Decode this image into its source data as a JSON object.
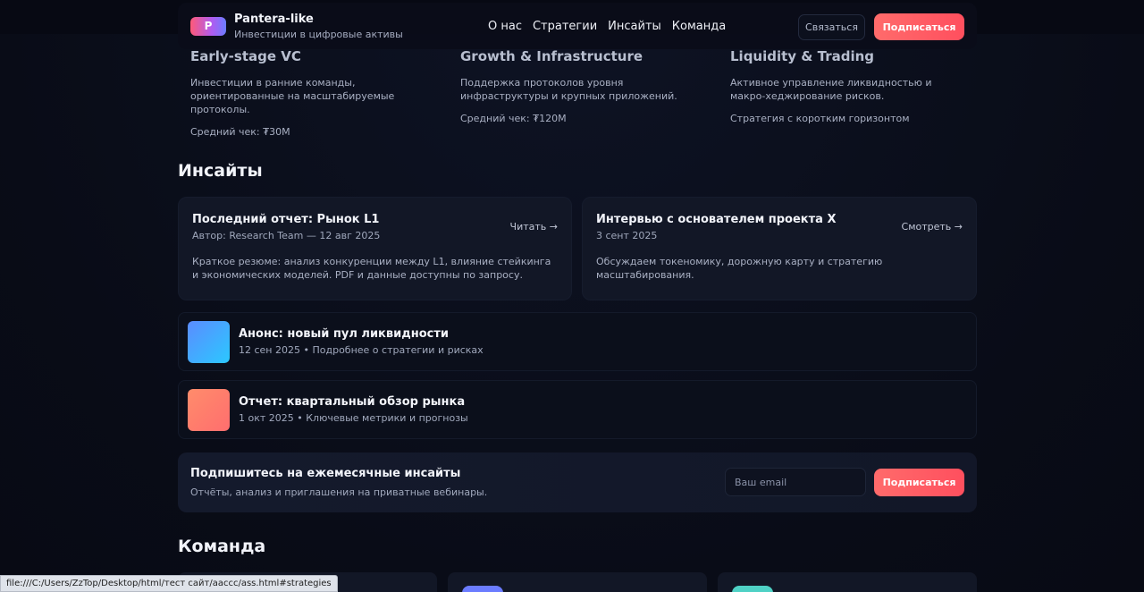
{
  "header": {
    "logo_letter": "P",
    "brand_name": "Pantera-like",
    "brand_tagline": "Инвестиции в цифровые активы",
    "nav": [
      "О нас",
      "Стратегии",
      "Инсайты",
      "Команда"
    ],
    "contact_label": "Связаться",
    "subscribe_label": "Подписаться"
  },
  "strategies": [
    {
      "title": "Early-stage VC",
      "desc": "Инвестиции в ранние команды, ориентированные на масштабируемые протоколы.",
      "meta": "Средний чек: ₮30M"
    },
    {
      "title": "Growth & Infrastructure",
      "desc": "Поддержка протоколов уровня инфраструктуры и крупных приложений.",
      "meta": "Средний чек: ₮120M"
    },
    {
      "title": "Liquidity & Trading",
      "desc": "Активное управление ликвидностью и макро-хеджирование рисков.",
      "meta": "Стратегия с коротким горизонтом"
    }
  ],
  "insights": {
    "title": "Инсайты",
    "cards": [
      {
        "title": "Последний отчет: Рынок L1",
        "sub": "Автор: Research Team — 12 авг 2025",
        "desc": "Краткое резюме: анализ конкуренции между L1, влияние стейкинга и экономических моделей. PDF и данные доступны по запросу.",
        "action": "Читать →"
      },
      {
        "title": "Интервью с основателем проекта X",
        "sub": "3 сент 2025",
        "desc": "Обсуждаем токеномику, дорожную карту и стратегию масштабирования.",
        "action": "Смотреть →"
      }
    ],
    "list": [
      {
        "title": "Анонс: новый пул ликвидности",
        "sub": "12 сен 2025 • Подробнее о стратегии и рисках"
      },
      {
        "title": "Отчет: квартальный обзор рынка",
        "sub": "1 окт 2025 • Ключевые метрики и прогнозы"
      }
    ]
  },
  "subscribe": {
    "title": "Подпишитесь на ежемесячные инсайты",
    "sub": "Отчёты, анализ и приглашения на приватные вебинары.",
    "email_placeholder": "Ваш email",
    "button": "Подписаться"
  },
  "team": {
    "title": "Команда"
  },
  "statusbar": {
    "url": "file:///C:/Users/ZzTop/Desktop/html/тест сайт/aaccc/ass.html#strategies"
  },
  "colors": {
    "accent": "#ff5a64",
    "background": "#0b0f1c",
    "card": "#121726"
  }
}
